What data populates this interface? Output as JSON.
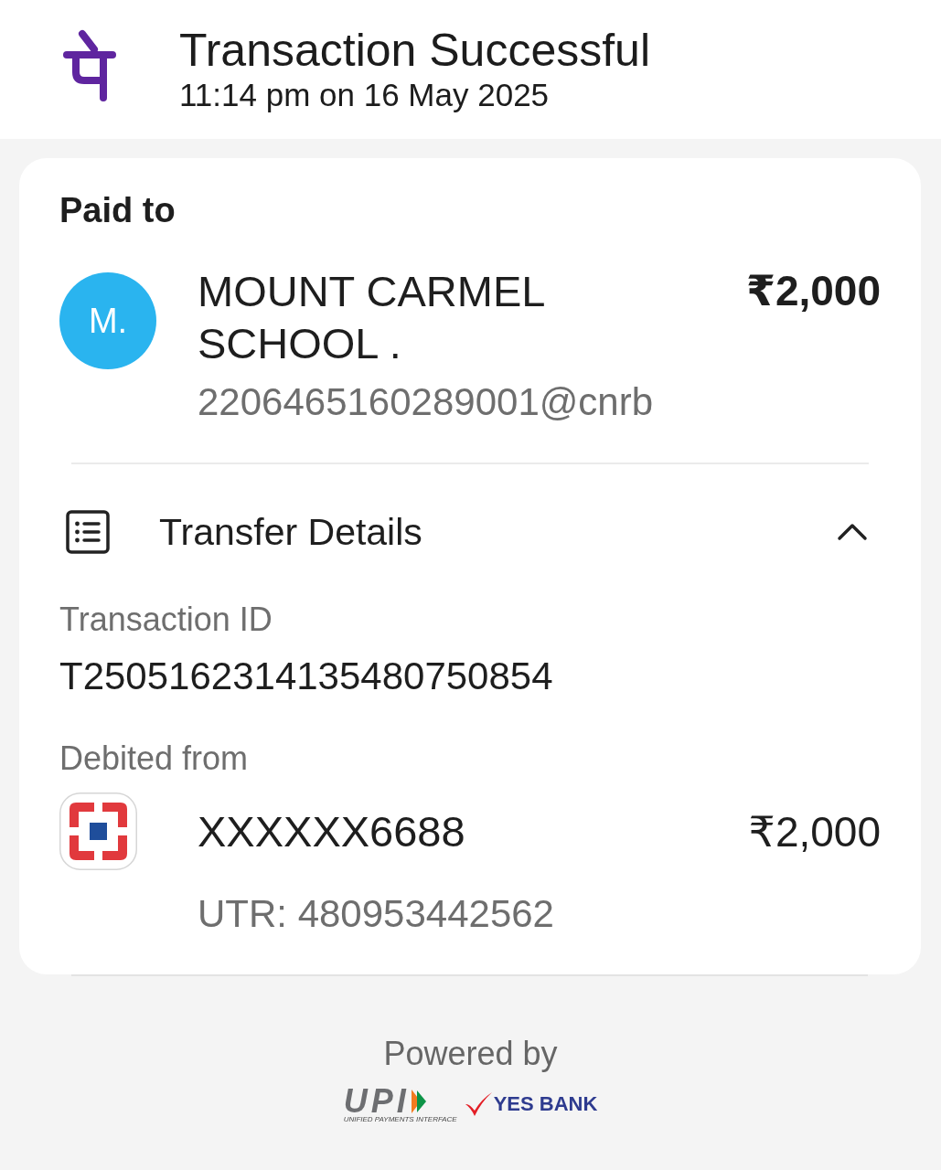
{
  "header": {
    "title": "Transaction Successful",
    "subtitle": "11:14 pm on 16 May 2025"
  },
  "paid_to": {
    "heading": "Paid to",
    "avatar": "M.",
    "name": "MOUNT CARMEL SCHOOL .",
    "upi_id": "2206465160289001@cnrb",
    "amount": "₹2,000"
  },
  "transfer_details": {
    "title": "Transfer Details",
    "expanded": true,
    "fields": [
      {
        "label": "Transaction ID",
        "value": "T2505162314135480750854"
      }
    ],
    "debited_from": {
      "label": "Debited from",
      "account": "XXXXXX6688",
      "amount": "₹2,000",
      "utr": "UTR: 480953442562"
    }
  },
  "footer": {
    "powered_by": "Powered by",
    "upi_logo": {
      "text": "UPI",
      "tagline": "UNIFIED PAYMENTS INTERFACE"
    },
    "bank_logo": "YES BANK"
  }
}
